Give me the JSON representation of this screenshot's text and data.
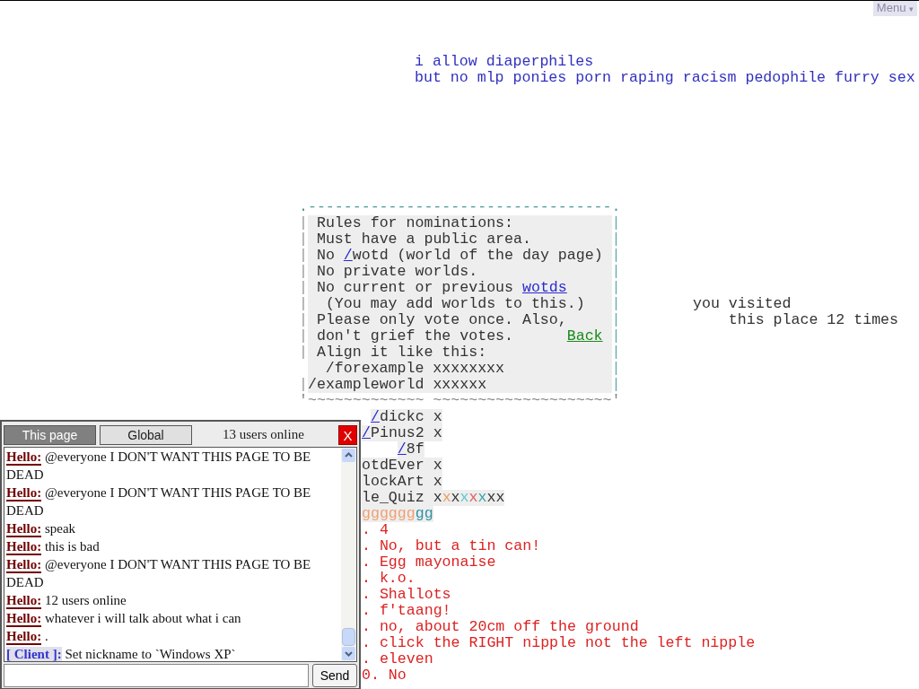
{
  "menu": {
    "label": "Menu",
    "caret": "▾"
  },
  "top_note": [
    "i allow diaperphiles",
    "but no mlp ponies porn raping racism pedophile furry sex"
  ],
  "rules_box": {
    "top": ".----------------------------------.",
    "bottom": "'~~~~~~~~~~~~~ ~~~~~~~~~~~~~~~~~~~~'",
    "lines": [
      {
        "left": "|",
        "right": "|",
        "segments": [
          {
            "kind": "plain",
            "text": " Rules for nominations:"
          }
        ]
      },
      {
        "left": "|",
        "right": "|",
        "segments": [
          {
            "kind": "plain",
            "text": " Must have a public area."
          }
        ]
      },
      {
        "left": "|",
        "right": "|",
        "segments": [
          {
            "kind": "plain",
            "text": " No "
          },
          {
            "kind": "link",
            "text": "/"
          },
          {
            "kind": "plain",
            "text": "wotd (world of the day page)"
          }
        ]
      },
      {
        "left": "|",
        "right": "|",
        "segments": [
          {
            "kind": "plain",
            "text": " No private worlds."
          }
        ]
      },
      {
        "left": "|",
        "right": "|",
        "segments": [
          {
            "kind": "plain",
            "text": " No current or previous "
          },
          {
            "kind": "link",
            "text": "wotds"
          }
        ]
      },
      {
        "left": "|",
        "right": "|",
        "segments": [
          {
            "kind": "plain",
            "text": "  (You may add worlds to this.)"
          }
        ]
      },
      {
        "left": "|",
        "right": "|",
        "segments": [
          {
            "kind": "plain",
            "text": " Please only vote once. Also,"
          }
        ]
      },
      {
        "left": "|",
        "right": "|",
        "segments": [
          {
            "kind": "plain",
            "text": " don't grief the votes.      "
          },
          {
            "kind": "back",
            "text": "Back"
          }
        ]
      },
      {
        "left": "|",
        "right": "|",
        "segments": [
          {
            "kind": "plain",
            "text": " Align it like this:"
          }
        ]
      },
      {
        "right": "|",
        "segments": [
          {
            "kind": "plain",
            "text": "  /forexample xxxxxxxx"
          }
        ]
      },
      {
        "left": "|",
        "right": "|",
        "segments": [
          {
            "kind": "plain",
            "text": "/exampleworld xxxxxx"
          }
        ]
      }
    ]
  },
  "visits_note": [
    "you visited",
    "    this place 12 times"
  ],
  "world_list": [
    [
      {
        "kind": "link",
        "text": "/"
      },
      {
        "kind": "plain",
        "text": "dickc x"
      }
    ],
    [
      {
        "kind": "link",
        "text": "/"
      },
      {
        "kind": "plain",
        "text": "Pinus2 x"
      }
    ],
    [
      {
        "kind": "link",
        "text": "/"
      },
      {
        "kind": "plain",
        "text": "8f"
      }
    ],
    [
      {
        "kind": "plain",
        "text": "otdEver x"
      }
    ],
    [
      {
        "kind": "plain",
        "text": "lockArt x"
      }
    ],
    [
      {
        "kind": "plain",
        "text": "le_Quiz x"
      },
      {
        "kind": "colored",
        "text": "x",
        "color": "#e8a060"
      },
      {
        "kind": "plain",
        "text": "x"
      },
      {
        "kind": "colored",
        "text": "x",
        "color": "#60c8c8"
      },
      {
        "kind": "colored",
        "text": "x",
        "color": "#e06060"
      },
      {
        "kind": "colored",
        "text": "x",
        "color": "#40a0a0"
      },
      {
        "kind": "plain",
        "text": "xx"
      }
    ],
    [
      {
        "kind": "colored",
        "text": "gggggg",
        "color": "#f0a070"
      },
      {
        "kind": "colored",
        "text": "gg",
        "color": "#3090a0"
      }
    ]
  ],
  "answers": [
    ". 4",
    ". No, but a tin can!",
    ". Egg mayonaise",
    ". k.o.",
    ". Shallots",
    ". f'taang!",
    ". no, about 20cm off the ground",
    ". click the RIGHT nipple not the left nipple",
    ". eleven",
    "0. No"
  ],
  "chat": {
    "tabs": [
      {
        "label": "This page",
        "selected": true
      },
      {
        "label": "Global",
        "selected": false
      }
    ],
    "online": "13 users online",
    "close": "X",
    "messages": [
      {
        "kind": "user",
        "name": "Hello:",
        "text": "@everyone I DON'T WANT THIS PAGE TO BE DEAD"
      },
      {
        "kind": "user",
        "name": "Hello:",
        "text": "@everyone I DON'T WANT THIS PAGE TO BE DEAD"
      },
      {
        "kind": "user",
        "name": "Hello:",
        "text": "speak"
      },
      {
        "kind": "user",
        "name": "Hello:",
        "text": "this is bad"
      },
      {
        "kind": "user",
        "name": "Hello:",
        "text": "@everyone I DON'T WANT THIS PAGE TO BE DEAD"
      },
      {
        "kind": "user",
        "name": "Hello:",
        "text": "12 users online"
      },
      {
        "kind": "user",
        "name": "Hello:",
        "text": "whatever i will talk about what i can"
      },
      {
        "kind": "user",
        "name": "Hello:",
        "text": "."
      },
      {
        "kind": "client",
        "name": "[ Client ]:",
        "text": "Set nickname to `Windows XP`"
      }
    ],
    "send": "Send"
  }
}
